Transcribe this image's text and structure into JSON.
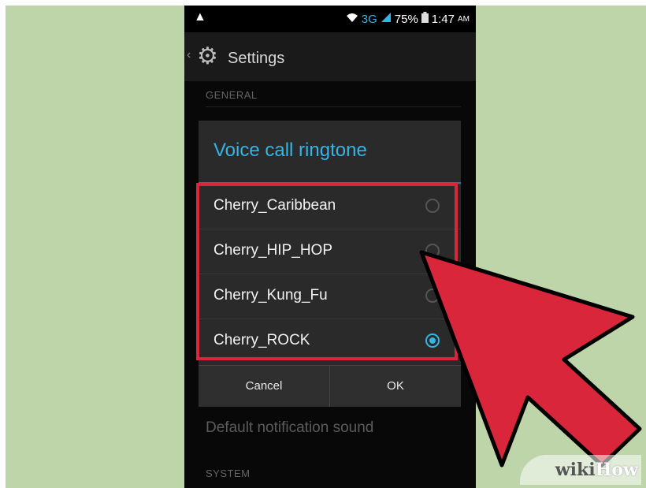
{
  "status_bar": {
    "warning_icon": "warning-triangle-icon",
    "network": "3G",
    "battery": "75%",
    "time": "1:47",
    "ampm": "AM"
  },
  "action_bar": {
    "title": "Settings"
  },
  "background": {
    "section_general": "GENERAL",
    "default_notification": "Default notification sound",
    "section_system": "SYSTEM"
  },
  "dialog": {
    "title": "Voice call ringtone",
    "options": [
      {
        "label": "Cherry_Caribbean",
        "checked": false
      },
      {
        "label": "Cherry_HIP_HOP",
        "checked": false
      },
      {
        "label": "Cherry_Kung_Fu",
        "checked": false
      },
      {
        "label": "Cherry_ROCK",
        "checked": true
      }
    ],
    "cancel_label": "Cancel",
    "ok_label": "OK"
  },
  "watermark": {
    "part1": "wiki",
    "part2": "How"
  },
  "colors": {
    "accent": "#33b5e5",
    "highlight": "#d9263a",
    "background": "#bdd5a8"
  }
}
